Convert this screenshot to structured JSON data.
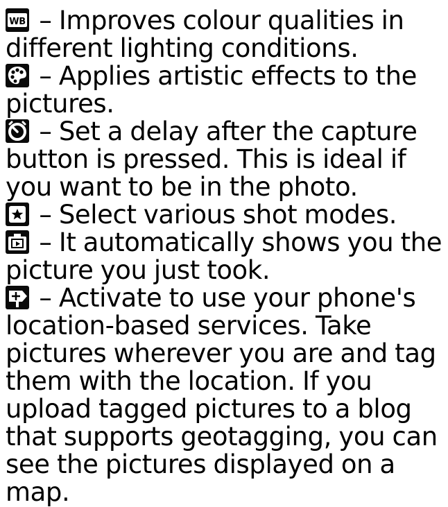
{
  "entries": [
    {
      "icon": "white-balance-icon",
      "text": " – Improves colour qualities in different lighting conditions."
    },
    {
      "icon": "palette-icon",
      "text": " – Applies artistic effects to the pictures."
    },
    {
      "icon": "self-timer-icon",
      "text": " – Set a delay after the capture button is pressed. This is ideal if you want to be in the photo."
    },
    {
      "icon": "shot-mode-star-icon",
      "text": " – Select various shot modes."
    },
    {
      "icon": "review-icon",
      "text": " – It automatically shows you the picture you just took."
    },
    {
      "icon": "geotag-icon",
      "text": " – Activate to use your phone's location-based services. Take pictures wherever you are and tag them with the location. If you upload tagged pictures to a blog that supports geotagging, you can see the pictures displayed on a map."
    }
  ]
}
